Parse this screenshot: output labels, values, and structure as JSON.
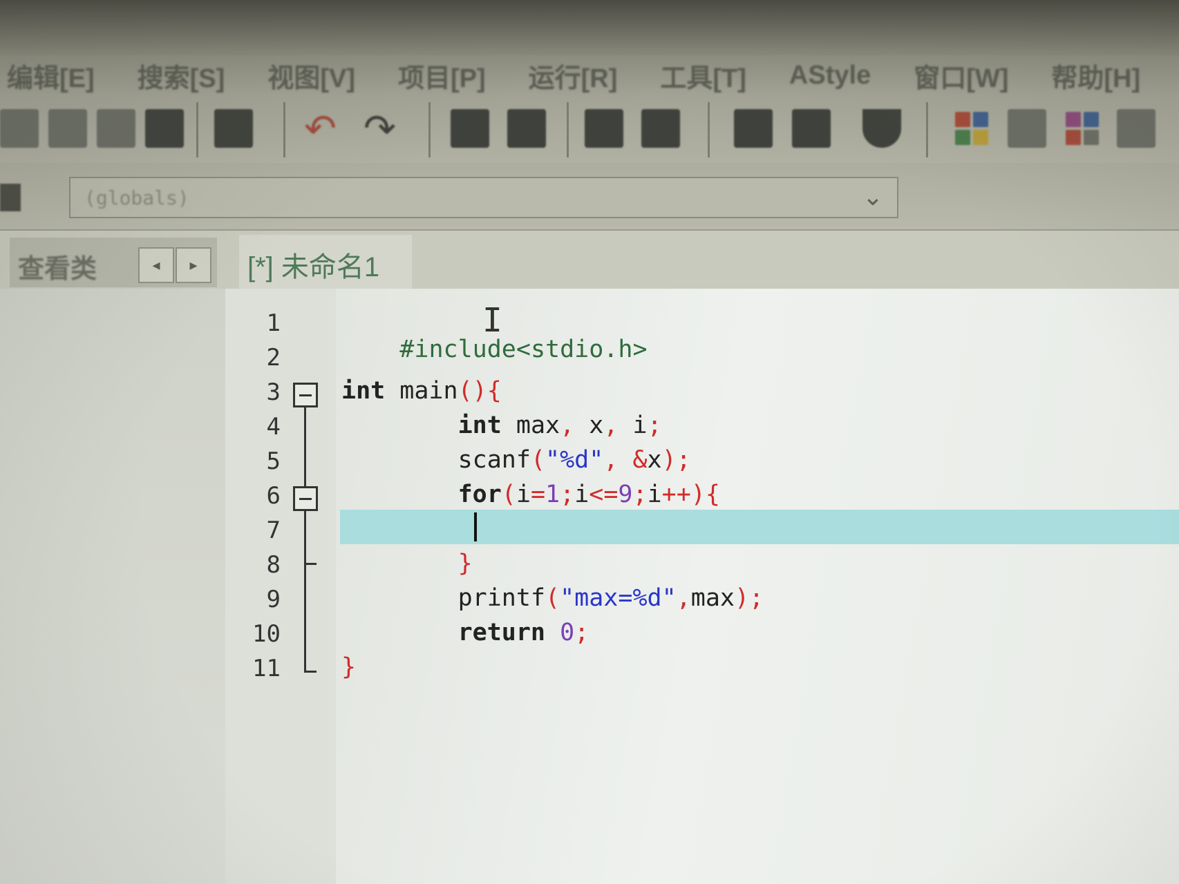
{
  "menu": {
    "items": [
      "编辑[E]",
      "搜索[S]",
      "视图[V]",
      "项目[P]",
      "运行[R]",
      "工具[T]",
      "AStyle",
      "窗口[W]",
      "帮助[H]"
    ]
  },
  "toolbar": {
    "icons": [
      "save-all-icon",
      "close-file-icon",
      "close-all-icon",
      "print-icon",
      "undo-icon",
      "redo-icon",
      "find-icon",
      "replace-icon",
      "indent-icon",
      "unindent-icon",
      "bookmark-icon",
      "goto-icon",
      "project-icon",
      "new-class-icon",
      "insert-icon",
      "layout-icon"
    ]
  },
  "scope": {
    "value": "(globals)"
  },
  "class_panel": {
    "label": "查看类",
    "prev": "◂",
    "next": "▸"
  },
  "editor_tab": {
    "label": "[*] 未命名1"
  },
  "editor": {
    "current_line": 7,
    "line_numbers": [
      "1",
      "2",
      "3",
      "4",
      "5",
      "6",
      "7",
      "8",
      "9",
      "10",
      "11"
    ],
    "fold_markers": [
      3,
      6
    ]
  },
  "code": {
    "l1": "#include<stdio.h>",
    "l3_kw": "int",
    "l3_name": " main",
    "l3_sym": "(){",
    "l4_kw": "int",
    "l4_a": " max",
    "l4_c1": ",",
    "l4_b": " x",
    "l4_c2": ",",
    "l4_c": " i",
    "l4_semi": ";",
    "l5_fn": "scanf",
    "l5_p1": "(",
    "l5_str": "\"%d\"",
    "l5_comma": ", &",
    "l5_x": "x",
    "l5_end": ");",
    "l6_kw": "for",
    "l6_p": "(",
    "l6_i1": "i",
    "l6_eq": "=",
    "l6_one": "1",
    "l6_s1": ";",
    "l6_i2": "i",
    "l6_le": "<=",
    "l6_nine": "9",
    "l6_s2": ";",
    "l6_i3": "i",
    "l6_inc": "++){",
    "l8": "}",
    "l9_fn": "printf",
    "l9_p": "(",
    "l9_str": "\"max=%d\"",
    "l9_c": ",",
    "l9_max": "max",
    "l9_end": ");",
    "l10_kw": "return",
    "l10_zero": "0",
    "l10_semi": ";",
    "l11": "}"
  }
}
